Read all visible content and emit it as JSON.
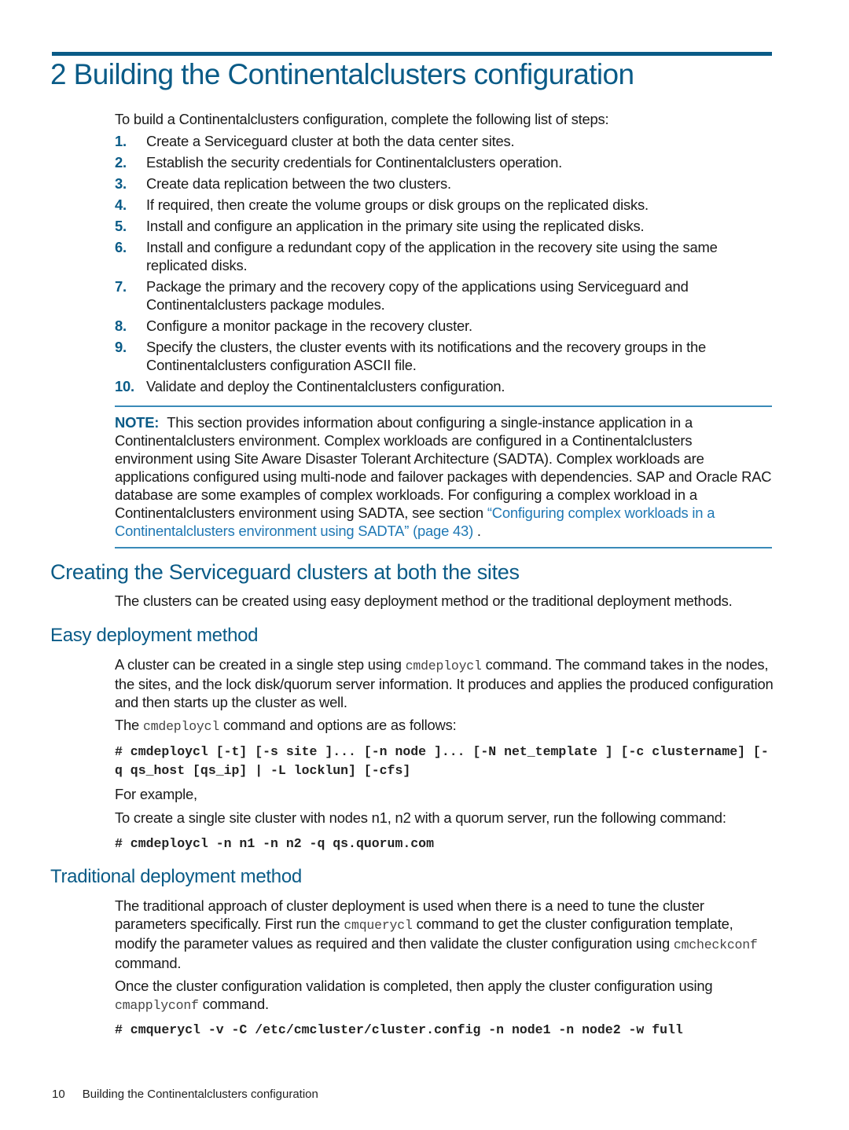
{
  "chapter": {
    "title": "2 Building the Continentalclusters configuration",
    "intro": "To build a Continentalclusters configuration, complete the following list of steps:",
    "steps": [
      {
        "num": "1.",
        "text": "Create a Serviceguard cluster at both the data center sites."
      },
      {
        "num": "2.",
        "text": "Establish the security credentials for Continentalclusters operation."
      },
      {
        "num": "3.",
        "text": "Create data replication between the two clusters."
      },
      {
        "num": "4.",
        "text": "If required, then create the volume groups or disk groups on the replicated disks."
      },
      {
        "num": "5.",
        "text": "Install and configure an application in the primary site using the replicated disks."
      },
      {
        "num": "6.",
        "text": "Install and configure a redundant copy of the application in the recovery site using the same replicated disks."
      },
      {
        "num": "7.",
        "text": "Package the primary and the recovery copy of the applications using Serviceguard and Continentalclusters package modules."
      },
      {
        "num": "8.",
        "text": "Configure a monitor package in the recovery cluster."
      },
      {
        "num": "9.",
        "text": "Specify the clusters, the cluster events with its notifications and the recovery groups in the Continentalclusters configuration ASCII file."
      },
      {
        "num": "10.",
        "text": "Validate and deploy the Continentalclusters configuration."
      }
    ]
  },
  "note": {
    "label": "NOTE:",
    "text": "This section provides information about configuring a single-instance application in a Continentalclusters environment. Complex workloads are configured in a Continentalclusters environment using Site Aware Disaster Tolerant Architecture (SADTA). Complex workloads are applications configured using multi-node and failover packages with dependencies. SAP and Oracle RAC database are some examples of complex workloads. For configuring a complex workload in a Continentalclusters environment using SADTA, see section ",
    "link": "“Configuring complex workloads in a Continentalclusters environment using SADTA” (page 43)",
    "tail": " ."
  },
  "section": {
    "title": "Creating the Serviceguard clusters at both the sites",
    "intro": "The clusters can be created using easy deployment method or the traditional deployment methods."
  },
  "easy": {
    "title": "Easy deployment method",
    "p1_a": "A cluster can be created in a single step using ",
    "p1_cmd": "cmdeploycl",
    "p1_b": " command. The command takes in the nodes, the sites, and the lock disk/quorum server information. It produces and applies the produced configuration and then starts up the cluster as well.",
    "p2_a": "The ",
    "p2_cmd": "cmdeploycl",
    "p2_b": " command and options are as follows:",
    "syntax": "# cmdeploycl [-t] [-s site ]... [-n node ]... [-N net_template ] [-c clustername] [-q qs_host [qs_ip] | -L locklun] [-cfs]",
    "for_example": "For example,",
    "example_desc": "To create a single site cluster with nodes n1, n2 with a quorum server, run the following command:",
    "example_cmd": "# cmdeploycl -n n1 -n n2 -q qs.quorum.com"
  },
  "traditional": {
    "title": "Traditional deployment method",
    "p1_a": "The traditional approach of cluster deployment is used when there is a need to tune the cluster parameters specifically. First run the ",
    "p1_cmd": "cmquerycl",
    "p1_b": " command to get the cluster configuration template, modify the parameter values as required and then validate the cluster configuration using ",
    "p1_cmd2": "cmcheckconf",
    "p1_c": " command.",
    "p2_a": "Once the cluster configuration validation is completed, then apply the cluster configuration using ",
    "p2_cmd": "cmapplyconf",
    "p2_b": " command.",
    "cmd": "# cmquerycl -v -C /etc/cmcluster/cluster.config -n node1 -n node2 -w full"
  },
  "footer": {
    "page": "10",
    "title": "Building the Continentalclusters configuration"
  }
}
